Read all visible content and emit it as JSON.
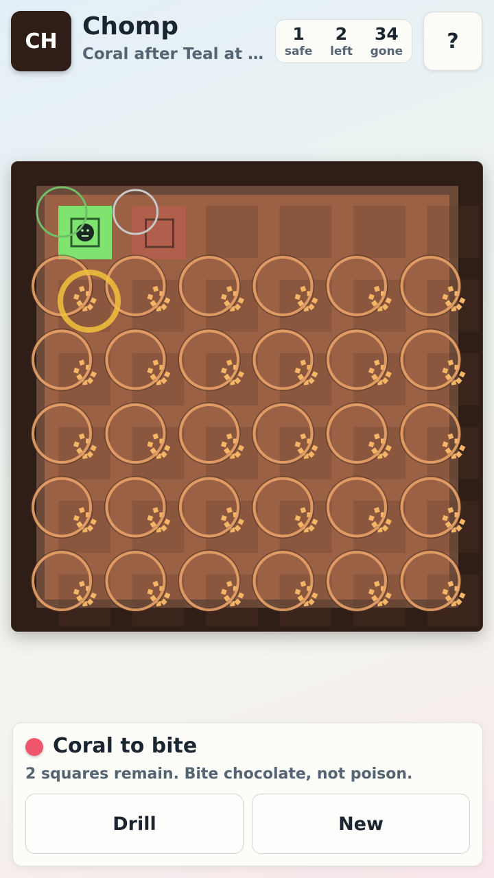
{
  "header": {
    "logo_text": "CH",
    "title": "Chomp",
    "subtitle": "Coral after Teal at …",
    "help_label": "?"
  },
  "stats": [
    {
      "value": "1",
      "label": "safe"
    },
    {
      "value": "2",
      "label": "left"
    },
    {
      "value": "34",
      "label": "gone"
    }
  ],
  "board": {
    "rows": 6,
    "cols": 6,
    "poison": {
      "row": 1,
      "col": 1,
      "icon": "poison-face-icon",
      "color": "#7ee36f"
    },
    "remaining": [
      {
        "row": 1,
        "col": 1
      },
      {
        "row": 1,
        "col": 2
      }
    ],
    "safe_hint": {
      "row": 1,
      "col": 2,
      "color": "#e0585d"
    },
    "highlight_ring": {
      "row": 2,
      "col": 1,
      "color": "#f2c23c"
    },
    "colors": {
      "chocolate": "#9a6145",
      "bitten_tile": "#5a3a2c",
      "crumbs": "#f5b567",
      "frame": "#2f1d17"
    }
  },
  "panel": {
    "turn_color": "#f0566b",
    "turn_label": "Coral to bite",
    "status": "2 squares remain. Bite chocolate, not poison.",
    "drill_label": "Drill",
    "new_label": "New"
  }
}
